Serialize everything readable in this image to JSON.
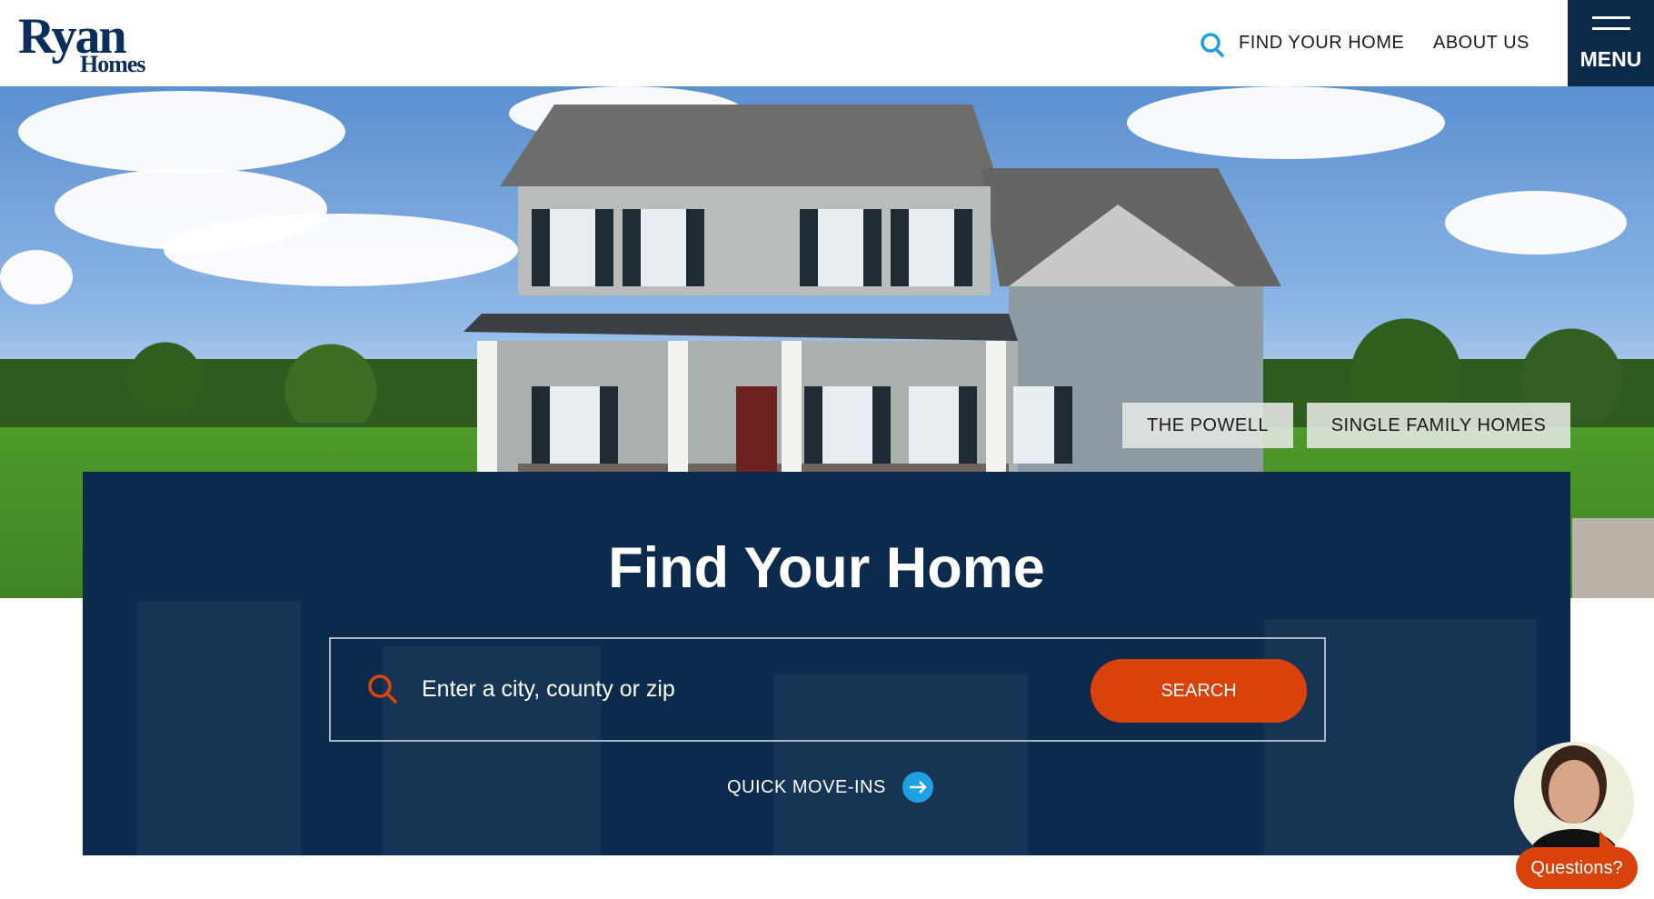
{
  "header": {
    "logo_text": "Ryan Homes",
    "nav": [
      {
        "label": "FIND YOUR HOME",
        "icon": "search-icon"
      },
      {
        "label": "ABOUT US"
      }
    ],
    "menu_label": "MENU"
  },
  "hero": {
    "tags": [
      "THE POWELL",
      "SINGLE FAMILY HOMES"
    ]
  },
  "search_panel": {
    "title": "Find Your Home",
    "placeholder": "Enter a city, county or zip",
    "search_label": "SEARCH",
    "quick_move_ins": "QUICK MOVE-INS"
  },
  "chat": {
    "label": "Questions?"
  },
  "colors": {
    "navy": "#0c2a4b",
    "orange": "#d9430b",
    "accent_blue": "#1da1e4"
  }
}
